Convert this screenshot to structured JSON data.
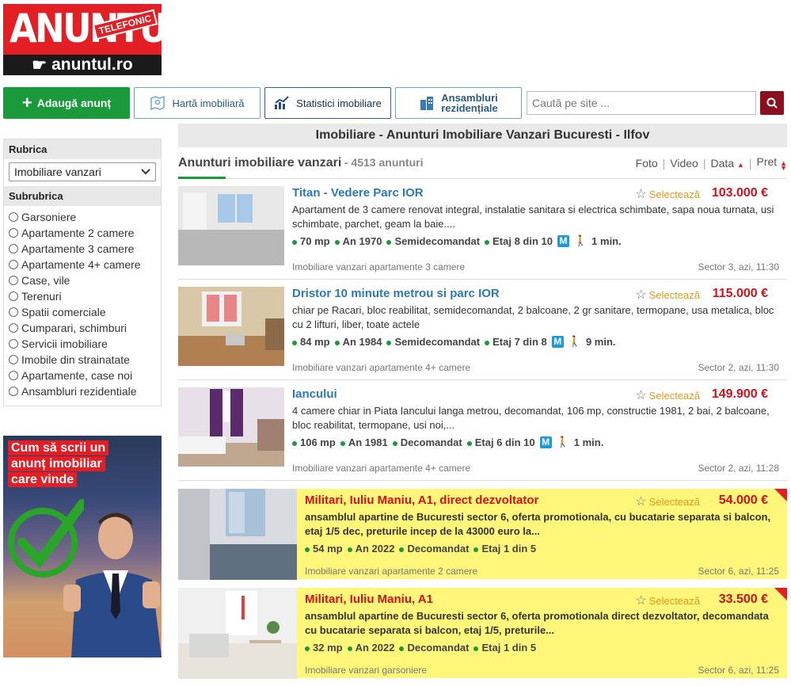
{
  "logo": {
    "word": "ANUNTUL",
    "tag": "TELEFONIC",
    "site": "anuntul.ro"
  },
  "toolbar": {
    "add": "Adaugă anunț",
    "harta": "Hartă imobiliară",
    "stat": "Statistici imobiliare",
    "ans1": "Ansambluri",
    "ans2": "rezidențiale",
    "search_placeholder": "Caută pe site ..."
  },
  "sidebar": {
    "rubrica_label": "Rubrica",
    "rubrica_value": "Imobiliare vanzari",
    "subrubrica_label": "Subrubrica",
    "items": [
      "Garsoniere",
      "Apartamente 2 camere",
      "Apartamente 3 camere",
      "Apartamente 4+ camere",
      "Case, vile",
      "Terenuri",
      "Spatii comerciale",
      "Cumparari, schimburi",
      "Servicii imobiliare",
      "Imobile din strainatate",
      "Apartamente, case noi",
      "Ansambluri rezidentiale"
    ]
  },
  "banner": {
    "l1": "Cum să scrii un",
    "l2": "anunț imobiliar",
    "l3": "care vinde"
  },
  "main": {
    "title": "Imobiliare - Anunturi Imobiliare Vanzari Bucuresti - Ilfov",
    "list_title": "Anunturi imobiliare vanzari",
    "count": "- 4513 anunturi",
    "sort": {
      "foto": "Foto",
      "video": "Video",
      "data": "Data",
      "pret": "Pret"
    }
  },
  "select_label": "Selectează",
  "listings": [
    {
      "title": "Titan - Vedere Parc IOR",
      "price": "103.000 €",
      "desc": "Apartament de 3 camere renovat integral, instalatie sanitara si electrica schimbate, sapa noua turnata, usi schimbate, parchet, geam la baie....",
      "a1": "70 mp",
      "a2": "An 1970",
      "a3": "Semidecomandat",
      "a4": "Etaj 8 din 10",
      "metro": "M",
      "walk": "1 min.",
      "cat": "Imobiliare vanzari apartamente 3 camere",
      "loc": "Sector 3, azi, 11:30"
    },
    {
      "title": "Dristor 10 minute metrou si parc IOR",
      "price": "115.000 €",
      "desc": "chiar pe Racari, bloc reabilitat, semidecomandat, 2 balcoane, 2 gr sanitare, termopane, usa metalica, bloc cu 2 lifturi, liber, toate actele",
      "a1": "84 mp",
      "a2": "An 1984",
      "a3": "Semidecomandat",
      "a4": "Etaj 7 din 8",
      "metro": "M",
      "walk": "9 min.",
      "cat": "Imobiliare vanzari apartamente 4+ camere",
      "loc": "Sector 2, azi, 11:30"
    },
    {
      "title": "Iancului",
      "price": "149.900 €",
      "desc": "4 camere chiar in Piata Iancului langa metrou, decomandat, 106 mp, constructie 1981, 2 bai, 2 balcoane, bloc reabilitat, termopane, usi noi,...",
      "a1": "106 mp",
      "a2": "An 1981",
      "a3": "Decomandat",
      "a4": "Etaj 6 din 10",
      "metro": "M",
      "walk": "1 min.",
      "cat": "Imobiliare vanzari apartamente 4+ camere",
      "loc": "Sector 2, azi, 11:28"
    },
    {
      "title": "Militari, Iuliu Maniu, A1, direct dezvoltator",
      "price": "54.000 €",
      "desc": "ansamblul apartine de Bucuresti sector 6, oferta promotionala, cu bucatarie separata si balcon, etaj 1/5 dec, preturile incep de la 43000 euro la...",
      "a1": "54 mp",
      "a2": "An 2022",
      "a3": "Decomandat",
      "a4": "Etaj 1 din 5",
      "cat": "Imobiliare vanzari apartamente 2 camere",
      "loc": "Sector 6, azi, 11:25"
    },
    {
      "title": "Militari, Iuliu Maniu, A1",
      "price": "33.500 €",
      "desc": "ansamblul apartine de Bucuresti sector 6, oferta promotionala direct dezvoltator, decomandata cu bucatarie separata si balcon, etaj 1/5, preturile...",
      "a1": "32 mp",
      "a2": "An 2022",
      "a3": "Decomandat",
      "a4": "Etaj 1 din 5",
      "cat": "Imobiliare vanzari garsoniere",
      "loc": "Sector 6, azi, 11:25"
    }
  ]
}
